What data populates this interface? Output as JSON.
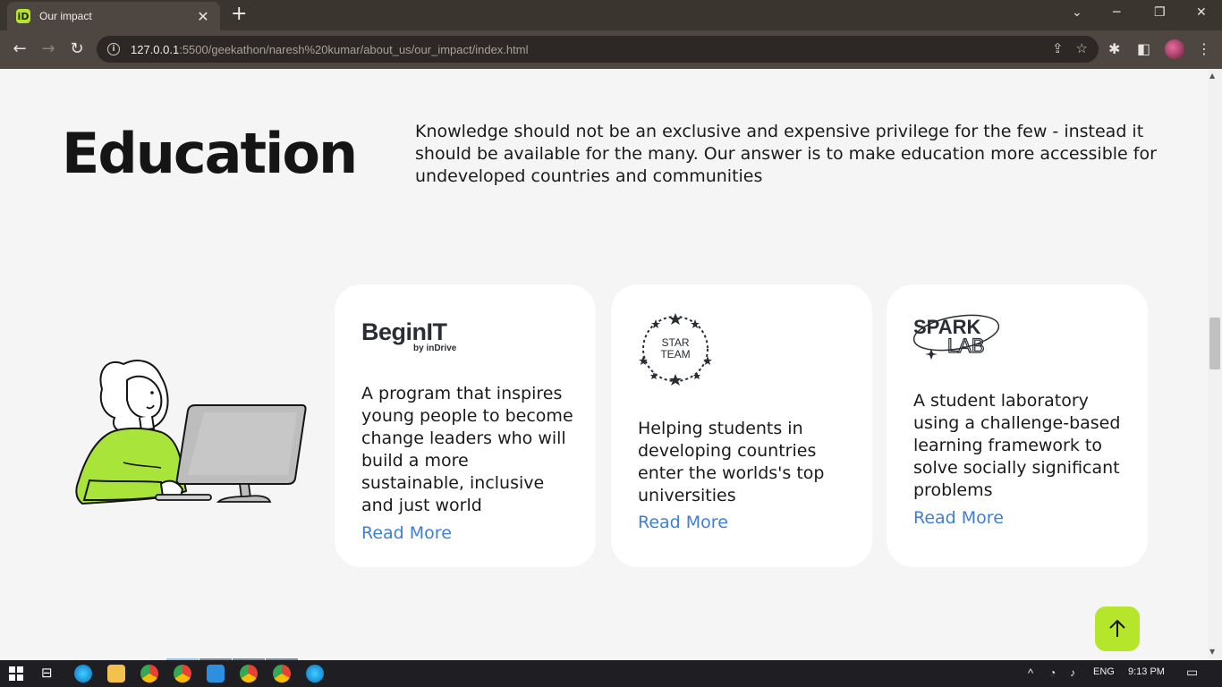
{
  "browser": {
    "tab_title": "Our impact",
    "favicon": "iD",
    "url_host": "127.0.0.1",
    "url_rest": ":5500/geekathon/naresh%20kumar/about_us/our_impact/index.html"
  },
  "section": {
    "title": "Education",
    "description": "Knowledge should not be an exclusive and expensive privilege for the few - instead it should be available for the many. Our answer is to make education more accessible for undeveloped countries and communities"
  },
  "cards": [
    {
      "logo_main": "BeginIT",
      "logo_sub": "by inDrive",
      "text": "A program that inspires young people to become change leaders who will build a more sustainable, inclusive and just world",
      "link": "Read More"
    },
    {
      "logo_line1": "STAR",
      "logo_line2": "TEAM",
      "text": "Helping students in developing countries enter the worlds's top universities",
      "link": "Read More"
    },
    {
      "logo_line1": "SPARK",
      "logo_line2": "LAB",
      "text": "A student laboratory using a challenge-based learning framework to solve socially significant problems",
      "link": "Read More"
    }
  ],
  "taskbar": {
    "language": "ENG",
    "time": "9:13 PM"
  },
  "colors": {
    "accent_green": "#b6e62b",
    "link_blue": "#3f7ed6",
    "page_bg": "#f5f5f5"
  }
}
